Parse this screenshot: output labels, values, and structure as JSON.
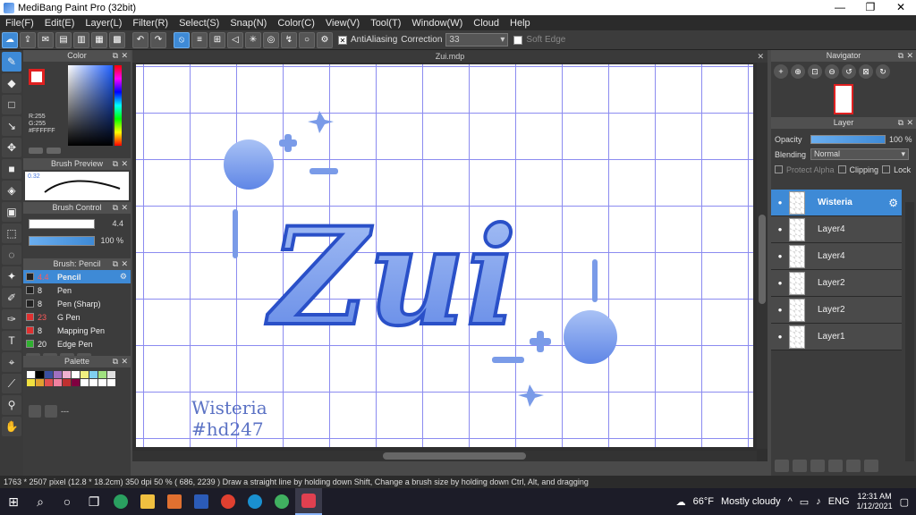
{
  "window": {
    "title": "MediBang Paint Pro (32bit)",
    "minimize": "—",
    "maximize": "❐",
    "close": "✕"
  },
  "menu": [
    "File(F)",
    "Edit(E)",
    "Layer(L)",
    "Filter(R)",
    "Select(S)",
    "Snap(N)",
    "Color(C)",
    "View(V)",
    "Tool(T)",
    "Window(W)",
    "Cloud",
    "Help"
  ],
  "toolbar": {
    "antialias_label": "AntiAliasing",
    "correction_label": "Correction",
    "correction_value": "33",
    "soft_edge_label": "Soft Edge"
  },
  "color_panel": {
    "title": "Color",
    "rgb_r": "R:255",
    "rgb_g": "G:255",
    "hex": "#FFFFFF"
  },
  "brush_preview": {
    "title": "Brush Preview",
    "size_label": "0.32"
  },
  "brush_control": {
    "title": "Brush Control",
    "size_value": "4.4",
    "opacity_value": "100 %"
  },
  "brush_list": {
    "title": "Brush: Pencil",
    "items": [
      {
        "size": "4.4",
        "name": "Pencil",
        "color": "#222222"
      },
      {
        "size": "8",
        "name": "Pen",
        "color": "#222222"
      },
      {
        "size": "8",
        "name": "Pen (Sharp)",
        "color": "#222222"
      },
      {
        "size": "23",
        "name": "G Pen",
        "color": "#e03030"
      },
      {
        "size": "8",
        "name": "Mapping Pen",
        "color": "#e03030"
      },
      {
        "size": "20",
        "name": "Edge Pen",
        "color": "#30b030"
      }
    ]
  },
  "palette": {
    "title": "Palette",
    "dashes": "---",
    "colors": [
      "#ffffff",
      "#000000",
      "#3a4fa0",
      "#a070c0",
      "#f0b0d0",
      "#ffffff",
      "#f0f080",
      "#80d0f0",
      "#a0e080",
      "#e0e0e0",
      "#f0e040",
      "#e0a030",
      "#e05050",
      "#f080a0",
      "#c03030",
      "#800040",
      "#ffffff",
      "#ffffff",
      "#ffffff",
      "#ffffff"
    ]
  },
  "document": {
    "tab_title": "Zui.mdp",
    "tab_close": "✕",
    "art_title": "Zui",
    "caption_line1": "Wisteria",
    "caption_line2": "#hd247"
  },
  "navigator": {
    "title": "Navigator"
  },
  "layer_panel": {
    "title": "Layer",
    "opacity_label": "Opacity",
    "opacity_value": "100 %",
    "blending_label": "Blending",
    "blending_value": "Normal",
    "protect_alpha": "Protect Alpha",
    "clipping": "Clipping",
    "lock": "Lock",
    "layers": [
      "Wisteria",
      "Layer4",
      "Layer4",
      "Layer2",
      "Layer2",
      "Layer1"
    ]
  },
  "status": {
    "text": "1763 * 2507 pixel  (12.8 * 18.2cm)  350 dpi  50 %  ( 686, 2239 )  Draw a straight line by holding down Shift, Change a brush size by holding down Ctrl, Alt, and dragging"
  },
  "taskbar": {
    "weather_temp": "66°F",
    "weather_desc": "Mostly cloudy",
    "lang": "ENG",
    "time": "12:31 AM",
    "date": "1/12/2021"
  },
  "colors": {
    "accent": "#3e8ad6",
    "grid": "#8b8bf0",
    "art_blue": "#6f95e8"
  }
}
